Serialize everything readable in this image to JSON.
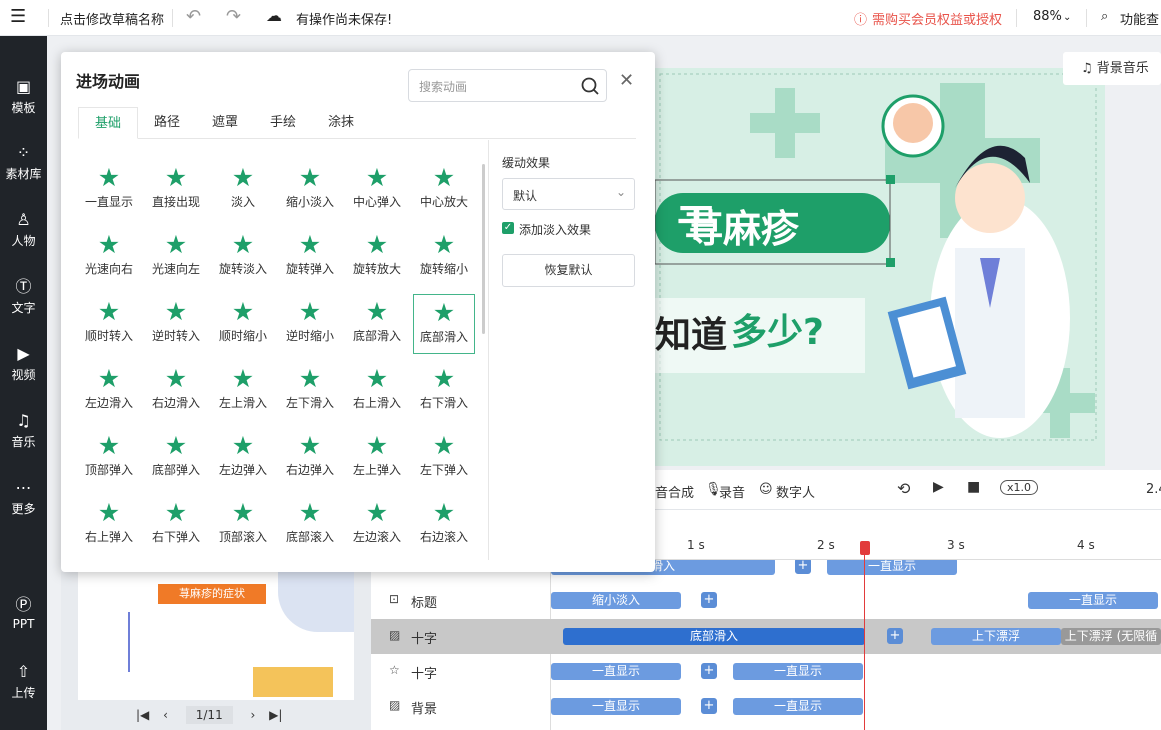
{
  "topbar": {
    "menu_icon": "menu-icon",
    "draft_name": "点击修改草稿名称",
    "save_status": "有操作尚未保存!",
    "vip_notice": "需购买会员权益或授权",
    "zoom": "88%",
    "features": "功能查"
  },
  "leftbar": [
    {
      "icon": "template-icon",
      "label": "模板"
    },
    {
      "icon": "assets-icon",
      "label": "素材库"
    },
    {
      "icon": "person-icon",
      "label": "人物"
    },
    {
      "icon": "text-icon",
      "label": "文字"
    },
    {
      "icon": "video-icon",
      "label": "视频"
    },
    {
      "icon": "music-icon",
      "label": "音乐"
    },
    {
      "icon": "more-icon",
      "label": "更多"
    },
    {
      "icon": "ppt-icon",
      "label": "PPT"
    },
    {
      "icon": "upload-icon",
      "label": "上传"
    }
  ],
  "panel": {
    "title": "进场动画",
    "search_placeholder": "搜索动画",
    "tabs": [
      "基础",
      "路径",
      "遮罩",
      "手绘",
      "涂抹"
    ],
    "animations": [
      "一直显示",
      "直接出现",
      "淡入",
      "缩小淡入",
      "中心弹入",
      "中心放大",
      "光速向右",
      "光速向左",
      "旋转淡入",
      "旋转弹入",
      "旋转放大",
      "旋转缩小",
      "顺时转入",
      "逆时转入",
      "顺时缩小",
      "逆时缩小",
      "底部滑入",
      "底部滑入",
      "左边滑入",
      "右边滑入",
      "左上滑入",
      "左下滑入",
      "右上滑入",
      "右下滑入",
      "顶部弹入",
      "底部弹入",
      "左边弹入",
      "右边弹入",
      "左上弹入",
      "左下弹入",
      "右上弹入",
      "右下弹入",
      "顶部滚入",
      "底部滚入",
      "左边滚入",
      "右边滚入"
    ],
    "selected_index": 17,
    "ease_label": "缓动效果",
    "ease_value": "默认",
    "fade_label": "添加淡入效果",
    "fade_checked": true,
    "reset_label": "恢复默认"
  },
  "canvas": {
    "bgm_label": "背景音乐",
    "title_text": "荨麻疹",
    "sub_text_1": "知道",
    "sub_text_2": "多少?"
  },
  "controls": {
    "synth": "音合成",
    "record": "录音",
    "digital_human": "数字人",
    "speed": "x1.0",
    "time": "2.4"
  },
  "ruler": [
    "1 s",
    "2 s",
    "3 s",
    "4 s"
  ],
  "tracks": [
    {
      "name": "",
      "icon": "",
      "bars": [
        "滑入",
        "一直显示"
      ]
    },
    {
      "name": "标题",
      "icon": "title-icon",
      "bars": [
        "缩小淡入",
        "一直显示"
      ]
    },
    {
      "name": "十字",
      "icon": "image-icon",
      "bars": [
        "底部滑入",
        "上下漂浮",
        "上下漂浮 (无限循"
      ]
    },
    {
      "name": "十字",
      "icon": "shape-icon",
      "bars": [
        "一直显示",
        "一直显示"
      ]
    },
    {
      "name": "背景",
      "icon": "image-icon",
      "bars": [
        "一直显示",
        "一直显示"
      ]
    }
  ],
  "thumb": {
    "heading": "荨麻疹的症状"
  },
  "pager": {
    "current": "1/11"
  },
  "colors": {
    "accent": "#1e9f69",
    "leftbar": "#202429",
    "vip": "#e8534a",
    "bar": "#6c9be0",
    "playhead": "#e23b3b"
  }
}
